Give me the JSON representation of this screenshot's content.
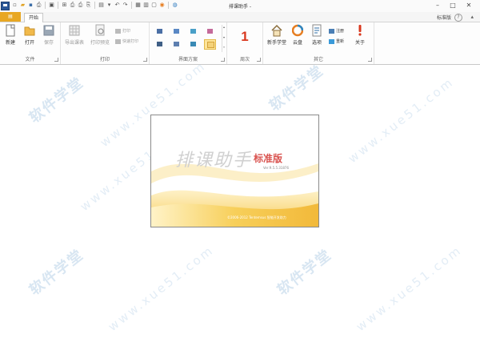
{
  "titlebar": {
    "title": "排课助手 -",
    "quick_access": [
      "new-icon",
      "open-icon",
      "save-icon",
      "print-icon",
      "preview-icon",
      "export-icon",
      "print-setup-icon",
      "scheme-icon",
      "undo-icon",
      "redo-icon",
      "calendar-icon",
      "grid-icon",
      "week-icon",
      "cloud-icon",
      "help-icon"
    ]
  },
  "tabs": {
    "file_label": "▤",
    "start_label": "开始",
    "edition": "标准版",
    "help": "?"
  },
  "ribbon": {
    "file_group": {
      "label": "文件",
      "new": "新建",
      "open": "打开",
      "save": "保存"
    },
    "print_group": {
      "label": "打印",
      "export_table": "导出课表",
      "print_preview": "打印预览",
      "print": "打印",
      "quick_print": "快速打印"
    },
    "scheme_group": {
      "label": "界面方案"
    },
    "week_group": {
      "label": "周次",
      "value": "1"
    },
    "other_group": {
      "label": "其它",
      "beginner": "新手学堂",
      "cloud": "云盘",
      "options": "选项",
      "register": "注册",
      "update": "重新",
      "about": "关于"
    }
  },
  "splash": {
    "title": "排课助手",
    "edition": "标准版",
    "version": "Ver:9.5.5.31876",
    "copyright": "©2006-2012  Tentemsus   智能开发助力"
  },
  "watermark": {
    "text": "软件学堂",
    "url": "www.xue51.com"
  },
  "colors": {
    "accent": "#e8a722",
    "splash_gold": "#f5c64a",
    "watermark": "#d8e6f2",
    "week_red": "#d9381e"
  }
}
